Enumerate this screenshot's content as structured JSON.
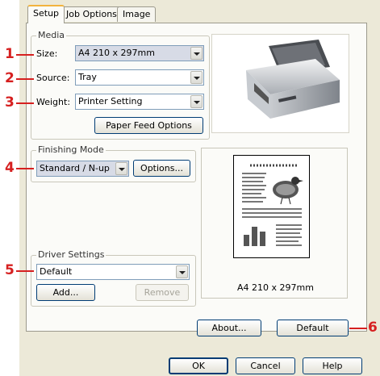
{
  "tabs": [
    {
      "label": "Setup",
      "active": true
    },
    {
      "label": "Job Options",
      "active": false
    },
    {
      "label": "Image",
      "active": false
    }
  ],
  "callouts": [
    "1",
    "2",
    "3",
    "4",
    "5",
    "6"
  ],
  "media": {
    "legend": "Media",
    "size_label": "Size:",
    "size_value": "A4 210 x 297mm",
    "source_label": "Source:",
    "source_value": "Tray",
    "weight_label": "Weight:",
    "weight_value": "Printer Setting",
    "paper_feed_button": "Paper Feed Options"
  },
  "finishing": {
    "legend": "Finishing Mode",
    "mode_value": "Standard / N-up",
    "options_button": "Options..."
  },
  "driver_settings": {
    "legend": "Driver Settings",
    "value": "Default",
    "add_button": "Add...",
    "remove_button": "Remove"
  },
  "preview": {
    "paper_size_caption": "A4 210 x 297mm"
  },
  "about_button": "About...",
  "default_button": "Default",
  "footer": {
    "ok": "OK",
    "cancel": "Cancel",
    "help": "Help"
  },
  "colors": {
    "callout": "#d62020",
    "dialog_bg": "#ece9d8",
    "panel_bg": "#fbfbf8",
    "tab_highlight": "#f2b33d"
  }
}
